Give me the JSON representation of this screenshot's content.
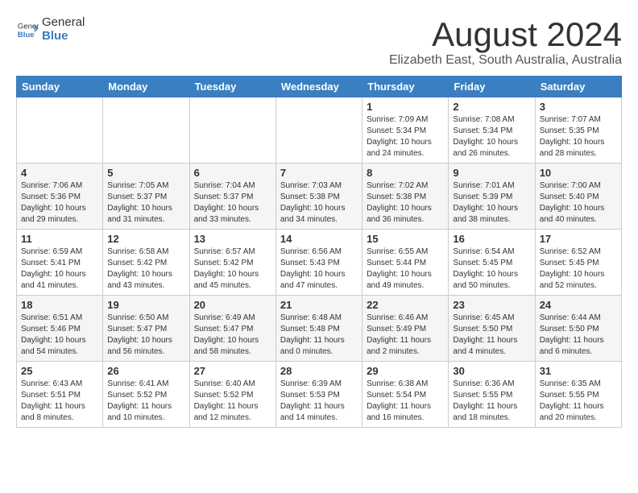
{
  "header": {
    "logo_general": "General",
    "logo_blue": "Blue",
    "month": "August 2024",
    "location": "Elizabeth East, South Australia, Australia"
  },
  "weekdays": [
    "Sunday",
    "Monday",
    "Tuesday",
    "Wednesday",
    "Thursday",
    "Friday",
    "Saturday"
  ],
  "weeks": [
    [
      {
        "day": "",
        "info": ""
      },
      {
        "day": "",
        "info": ""
      },
      {
        "day": "",
        "info": ""
      },
      {
        "day": "",
        "info": ""
      },
      {
        "day": "1",
        "info": "Sunrise: 7:09 AM\nSunset: 5:34 PM\nDaylight: 10 hours\nand 24 minutes."
      },
      {
        "day": "2",
        "info": "Sunrise: 7:08 AM\nSunset: 5:34 PM\nDaylight: 10 hours\nand 26 minutes."
      },
      {
        "day": "3",
        "info": "Sunrise: 7:07 AM\nSunset: 5:35 PM\nDaylight: 10 hours\nand 28 minutes."
      }
    ],
    [
      {
        "day": "4",
        "info": "Sunrise: 7:06 AM\nSunset: 5:36 PM\nDaylight: 10 hours\nand 29 minutes."
      },
      {
        "day": "5",
        "info": "Sunrise: 7:05 AM\nSunset: 5:37 PM\nDaylight: 10 hours\nand 31 minutes."
      },
      {
        "day": "6",
        "info": "Sunrise: 7:04 AM\nSunset: 5:37 PM\nDaylight: 10 hours\nand 33 minutes."
      },
      {
        "day": "7",
        "info": "Sunrise: 7:03 AM\nSunset: 5:38 PM\nDaylight: 10 hours\nand 34 minutes."
      },
      {
        "day": "8",
        "info": "Sunrise: 7:02 AM\nSunset: 5:38 PM\nDaylight: 10 hours\nand 36 minutes."
      },
      {
        "day": "9",
        "info": "Sunrise: 7:01 AM\nSunset: 5:39 PM\nDaylight: 10 hours\nand 38 minutes."
      },
      {
        "day": "10",
        "info": "Sunrise: 7:00 AM\nSunset: 5:40 PM\nDaylight: 10 hours\nand 40 minutes."
      }
    ],
    [
      {
        "day": "11",
        "info": "Sunrise: 6:59 AM\nSunset: 5:41 PM\nDaylight: 10 hours\nand 41 minutes."
      },
      {
        "day": "12",
        "info": "Sunrise: 6:58 AM\nSunset: 5:42 PM\nDaylight: 10 hours\nand 43 minutes."
      },
      {
        "day": "13",
        "info": "Sunrise: 6:57 AM\nSunset: 5:42 PM\nDaylight: 10 hours\nand 45 minutes."
      },
      {
        "day": "14",
        "info": "Sunrise: 6:56 AM\nSunset: 5:43 PM\nDaylight: 10 hours\nand 47 minutes."
      },
      {
        "day": "15",
        "info": "Sunrise: 6:55 AM\nSunset: 5:44 PM\nDaylight: 10 hours\nand 49 minutes."
      },
      {
        "day": "16",
        "info": "Sunrise: 6:54 AM\nSunset: 5:45 PM\nDaylight: 10 hours\nand 50 minutes."
      },
      {
        "day": "17",
        "info": "Sunrise: 6:52 AM\nSunset: 5:45 PM\nDaylight: 10 hours\nand 52 minutes."
      }
    ],
    [
      {
        "day": "18",
        "info": "Sunrise: 6:51 AM\nSunset: 5:46 PM\nDaylight: 10 hours\nand 54 minutes."
      },
      {
        "day": "19",
        "info": "Sunrise: 6:50 AM\nSunset: 5:47 PM\nDaylight: 10 hours\nand 56 minutes."
      },
      {
        "day": "20",
        "info": "Sunrise: 6:49 AM\nSunset: 5:47 PM\nDaylight: 10 hours\nand 58 minutes."
      },
      {
        "day": "21",
        "info": "Sunrise: 6:48 AM\nSunset: 5:48 PM\nDaylight: 11 hours\nand 0 minutes."
      },
      {
        "day": "22",
        "info": "Sunrise: 6:46 AM\nSunset: 5:49 PM\nDaylight: 11 hours\nand 2 minutes."
      },
      {
        "day": "23",
        "info": "Sunrise: 6:45 AM\nSunset: 5:50 PM\nDaylight: 11 hours\nand 4 minutes."
      },
      {
        "day": "24",
        "info": "Sunrise: 6:44 AM\nSunset: 5:50 PM\nDaylight: 11 hours\nand 6 minutes."
      }
    ],
    [
      {
        "day": "25",
        "info": "Sunrise: 6:43 AM\nSunset: 5:51 PM\nDaylight: 11 hours\nand 8 minutes."
      },
      {
        "day": "26",
        "info": "Sunrise: 6:41 AM\nSunset: 5:52 PM\nDaylight: 11 hours\nand 10 minutes."
      },
      {
        "day": "27",
        "info": "Sunrise: 6:40 AM\nSunset: 5:52 PM\nDaylight: 11 hours\nand 12 minutes."
      },
      {
        "day": "28",
        "info": "Sunrise: 6:39 AM\nSunset: 5:53 PM\nDaylight: 11 hours\nand 14 minutes."
      },
      {
        "day": "29",
        "info": "Sunrise: 6:38 AM\nSunset: 5:54 PM\nDaylight: 11 hours\nand 16 minutes."
      },
      {
        "day": "30",
        "info": "Sunrise: 6:36 AM\nSunset: 5:55 PM\nDaylight: 11 hours\nand 18 minutes."
      },
      {
        "day": "31",
        "info": "Sunrise: 6:35 AM\nSunset: 5:55 PM\nDaylight: 11 hours\nand 20 minutes."
      }
    ]
  ]
}
